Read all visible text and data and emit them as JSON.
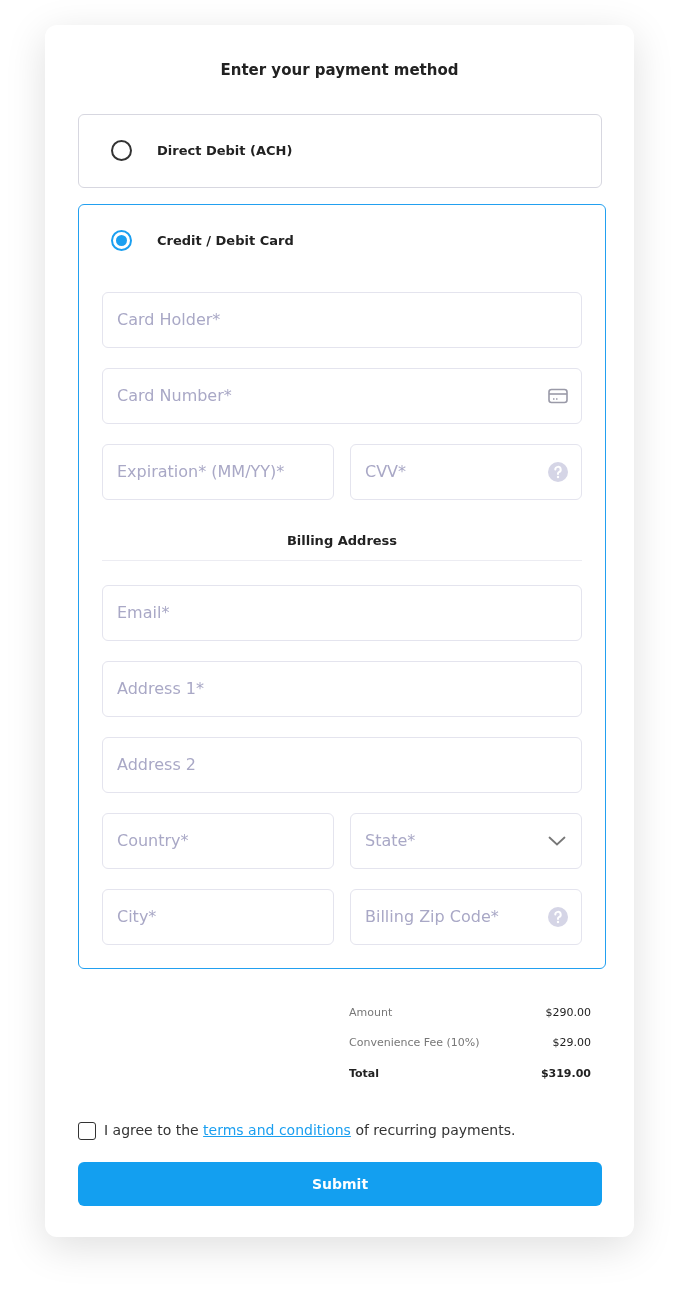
{
  "title": "Enter your payment method",
  "payment_methods": [
    {
      "label": "Direct Debit (ACH)",
      "selected": false
    },
    {
      "label": "Credit / Debit Card",
      "selected": true,
      "form": {
        "card_rows": [
          {
            "fields": [
              {
                "placeholder": "Card Holder*",
                "kind": "text"
              }
            ]
          },
          {
            "fields": [
              {
                "placeholder": "Card Number*",
                "kind": "card"
              }
            ]
          },
          {
            "fields": [
              {
                "placeholder": "Expiration* (MM/YY)*",
                "kind": "text"
              },
              {
                "placeholder": "CVV*",
                "kind": "help"
              }
            ]
          }
        ],
        "billing_heading": "Billing Address",
        "billing_rows": [
          {
            "fields": [
              {
                "placeholder": "Email*",
                "kind": "text"
              }
            ]
          },
          {
            "fields": [
              {
                "placeholder": "Address 1*",
                "kind": "text"
              }
            ]
          },
          {
            "fields": [
              {
                "placeholder": "Address 2",
                "kind": "text"
              }
            ]
          },
          {
            "fields": [
              {
                "placeholder": "Country*",
                "kind": "text"
              },
              {
                "placeholder": "State*",
                "kind": "select"
              }
            ]
          },
          {
            "fields": [
              {
                "placeholder": "City*",
                "kind": "text"
              },
              {
                "placeholder": "Billing Zip Code*",
                "kind": "help"
              }
            ]
          }
        ]
      }
    }
  ],
  "summary": [
    {
      "label": "Amount",
      "value": "$290.00",
      "kind": "line"
    },
    {
      "label": "Convenience Fee (10%)",
      "value": "$29.00",
      "kind": "line"
    },
    {
      "label": "Total",
      "value": "$319.00",
      "kind": "total"
    }
  ],
  "agreement": {
    "checked": false,
    "before": "I agree to the",
    "link": "terms and conditions",
    "after": "of recurring payments."
  },
  "submit": "Submit"
}
